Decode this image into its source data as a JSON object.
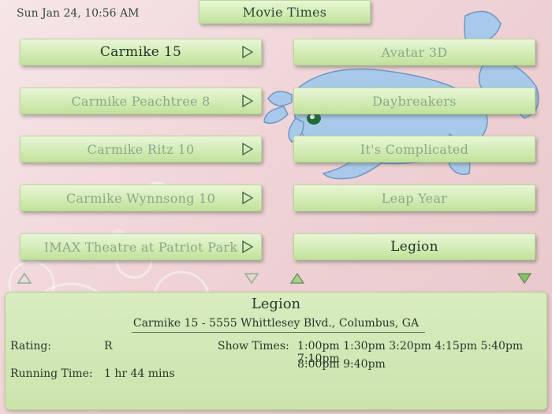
{
  "status": {
    "datetime": "Sun Jan 24, 10:56 AM"
  },
  "header": {
    "title": "Movie Times"
  },
  "theaters": [
    {
      "name": "Carmike 15",
      "state": "selected"
    },
    {
      "name": "Carmike Peachtree 8",
      "state": "dim"
    },
    {
      "name": "Carmike Ritz 10",
      "state": "dim"
    },
    {
      "name": "Carmike Wynnsong 10",
      "state": "dim"
    },
    {
      "name": "IMAX Theatre at Patriot Park",
      "state": "dim"
    }
  ],
  "movies": [
    {
      "title": "Avatar 3D",
      "state": "dim"
    },
    {
      "title": "Daybreakers",
      "state": "dim"
    },
    {
      "title": "It's Complicated",
      "state": "dim"
    },
    {
      "title": "Leap Year",
      "state": "dim"
    },
    {
      "title": "Legion",
      "state": "selected"
    }
  ],
  "details": {
    "title": "Legion",
    "location": "Carmike 15 - 5555 Whittlesey Blvd., Columbus, GA",
    "rating_label": "Rating:",
    "rating_value": "R",
    "running_label": "Running Time:",
    "running_value": "1 hr 44 mins",
    "showtimes_label": "Show Times:",
    "showtimes_line1": "1:00pm 1:30pm 3:20pm 4:15pm 5:40pm 7:10pm",
    "showtimes_line2": "8:00pm 9:40pm"
  },
  "icons": {
    "play": "play-arrow-icon",
    "up": "scroll-up-icon",
    "down": "scroll-down-icon"
  },
  "colors": {
    "button": "#d3ecb5",
    "text": "#2f4a33",
    "dim_text": "#8aa889",
    "background": "#efd3d6"
  }
}
